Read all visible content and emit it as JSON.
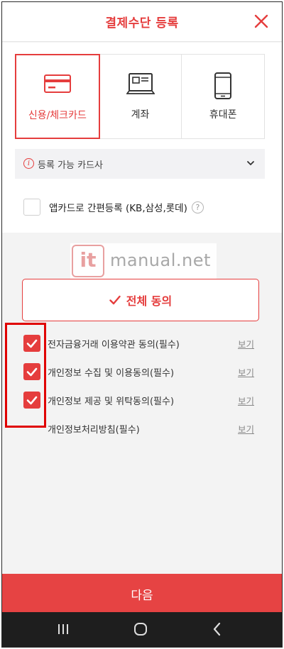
{
  "header": {
    "title": "결제수단 등록"
  },
  "payment_tabs": [
    {
      "label": "신용/체크카드",
      "icon": "credit-card-icon",
      "active": true
    },
    {
      "label": "계좌",
      "icon": "bank-account-icon",
      "active": false
    },
    {
      "label": "휴대폰",
      "icon": "mobile-phone-icon",
      "active": false
    }
  ],
  "card_issuers": {
    "label": "등록 가능 카드사"
  },
  "app_card": {
    "label": "앱카드로 간편등록 (KB,삼성,롯데)",
    "help": "?"
  },
  "watermark": {
    "logo": "it",
    "text": "manual.net"
  },
  "agree_all": {
    "label": "전체 동의"
  },
  "terms": [
    {
      "label": "전자금융거래 이용약관 동의(필수)",
      "checked": true,
      "view": "보기"
    },
    {
      "label": "개인정보 수집 및 이용동의(필수)",
      "checked": true,
      "view": "보기"
    },
    {
      "label": "개인정보 제공 및 위탁동의(필수)",
      "checked": true,
      "view": "보기"
    },
    {
      "label": "개인정보처리방침(필수)",
      "checked": false,
      "view": "보기"
    }
  ],
  "next_button": {
    "label": "다음"
  },
  "colors": {
    "accent": "#e53d3d",
    "navbar": "#1e1e1e"
  }
}
